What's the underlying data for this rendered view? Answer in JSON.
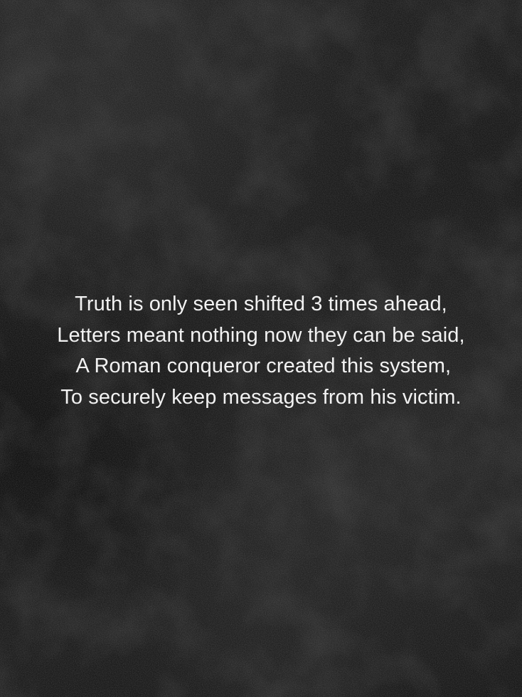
{
  "poem": {
    "lines": [
      "Truth is only seen shifted 3 times ahead,",
      "Letters meant nothing now they can be said,",
      " A Roman conqueror created this system,",
      "To securely keep messages from his victim."
    ]
  },
  "colors": {
    "background": "#1c1c1c",
    "text": "#f2f2f2"
  }
}
